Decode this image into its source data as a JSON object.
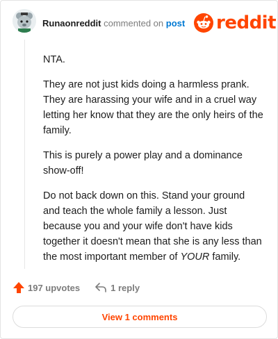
{
  "header": {
    "username": "Runaonreddit",
    "action_text": "commented on",
    "post_link": "post",
    "brand": "reddit"
  },
  "comment": {
    "paragraphs": [
      "NTA.",
      "They are not just kids doing a harmless prank. They are harassing your wife and in a cruel way letting her know that they are the only heirs of the family.",
      "This is purely a power play and a dominance show-off!"
    ],
    "last_paragraph_main": "Do not back down on this. Stand your ground and teach the whole family a lesson. Just because you and your wife don't have kids together it doesn't mean that she is any less than the most important member of ",
    "last_paragraph_emphasis": "YOUR",
    "last_paragraph_end": " family."
  },
  "actions": {
    "upvotes": "197 upvotes",
    "replies": "1 reply"
  },
  "footer": {
    "view_comments": "View 1 comments"
  },
  "colors": {
    "brand": "#ff4500",
    "link": "#0079d3",
    "muted": "#7c7c7c"
  }
}
